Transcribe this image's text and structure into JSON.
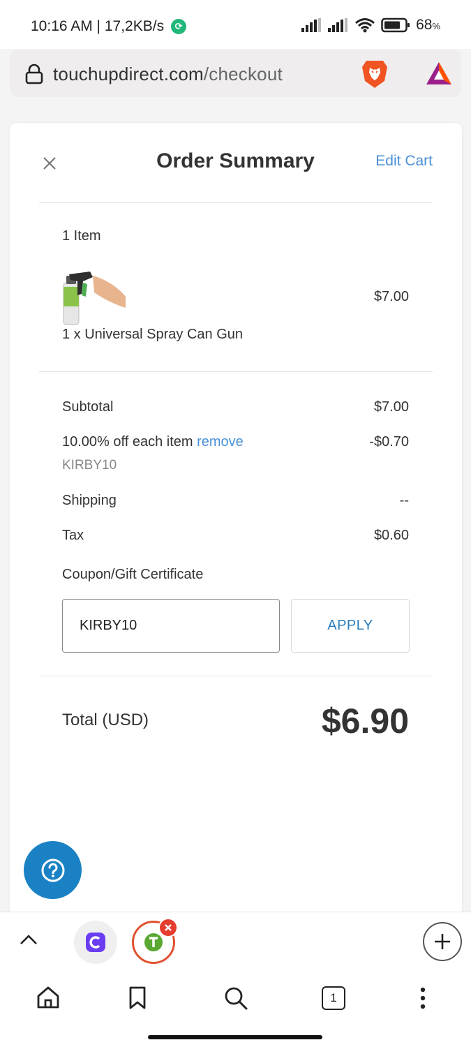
{
  "status_bar": {
    "time": "10:16 AM | 17,2KB/s",
    "battery": "68",
    "battery_unit": "%"
  },
  "browser": {
    "url_host": "touchupdirect.com",
    "url_path": "/checkout",
    "tab_count": "1"
  },
  "order_summary": {
    "title": "Order Summary",
    "edit_cart_label": "Edit Cart",
    "item_count": "1 Item",
    "items": [
      {
        "name": "1 x Universal Spray Can Gun",
        "price": "$7.00",
        "image_icon": "spray-can-gun-image"
      }
    ],
    "subtotal_label": "Subtotal",
    "subtotal_value": "$7.00",
    "discount_label": "10.00% off each item",
    "discount_remove_label": "remove",
    "discount_code": "KIRBY10",
    "discount_value": "-$0.70",
    "shipping_label": "Shipping",
    "shipping_value": "--",
    "tax_label": "Tax",
    "tax_value": "$0.60",
    "coupon_label": "Coupon/Gift Certificate",
    "coupon_input_value": "KIRBY10",
    "apply_label": "APPLY",
    "total_label": "Total (USD)",
    "total_value": "$6.90"
  },
  "colors": {
    "link": "#4a90d9",
    "help_button": "#1a82c4",
    "apply_text": "#2a7dbb"
  }
}
